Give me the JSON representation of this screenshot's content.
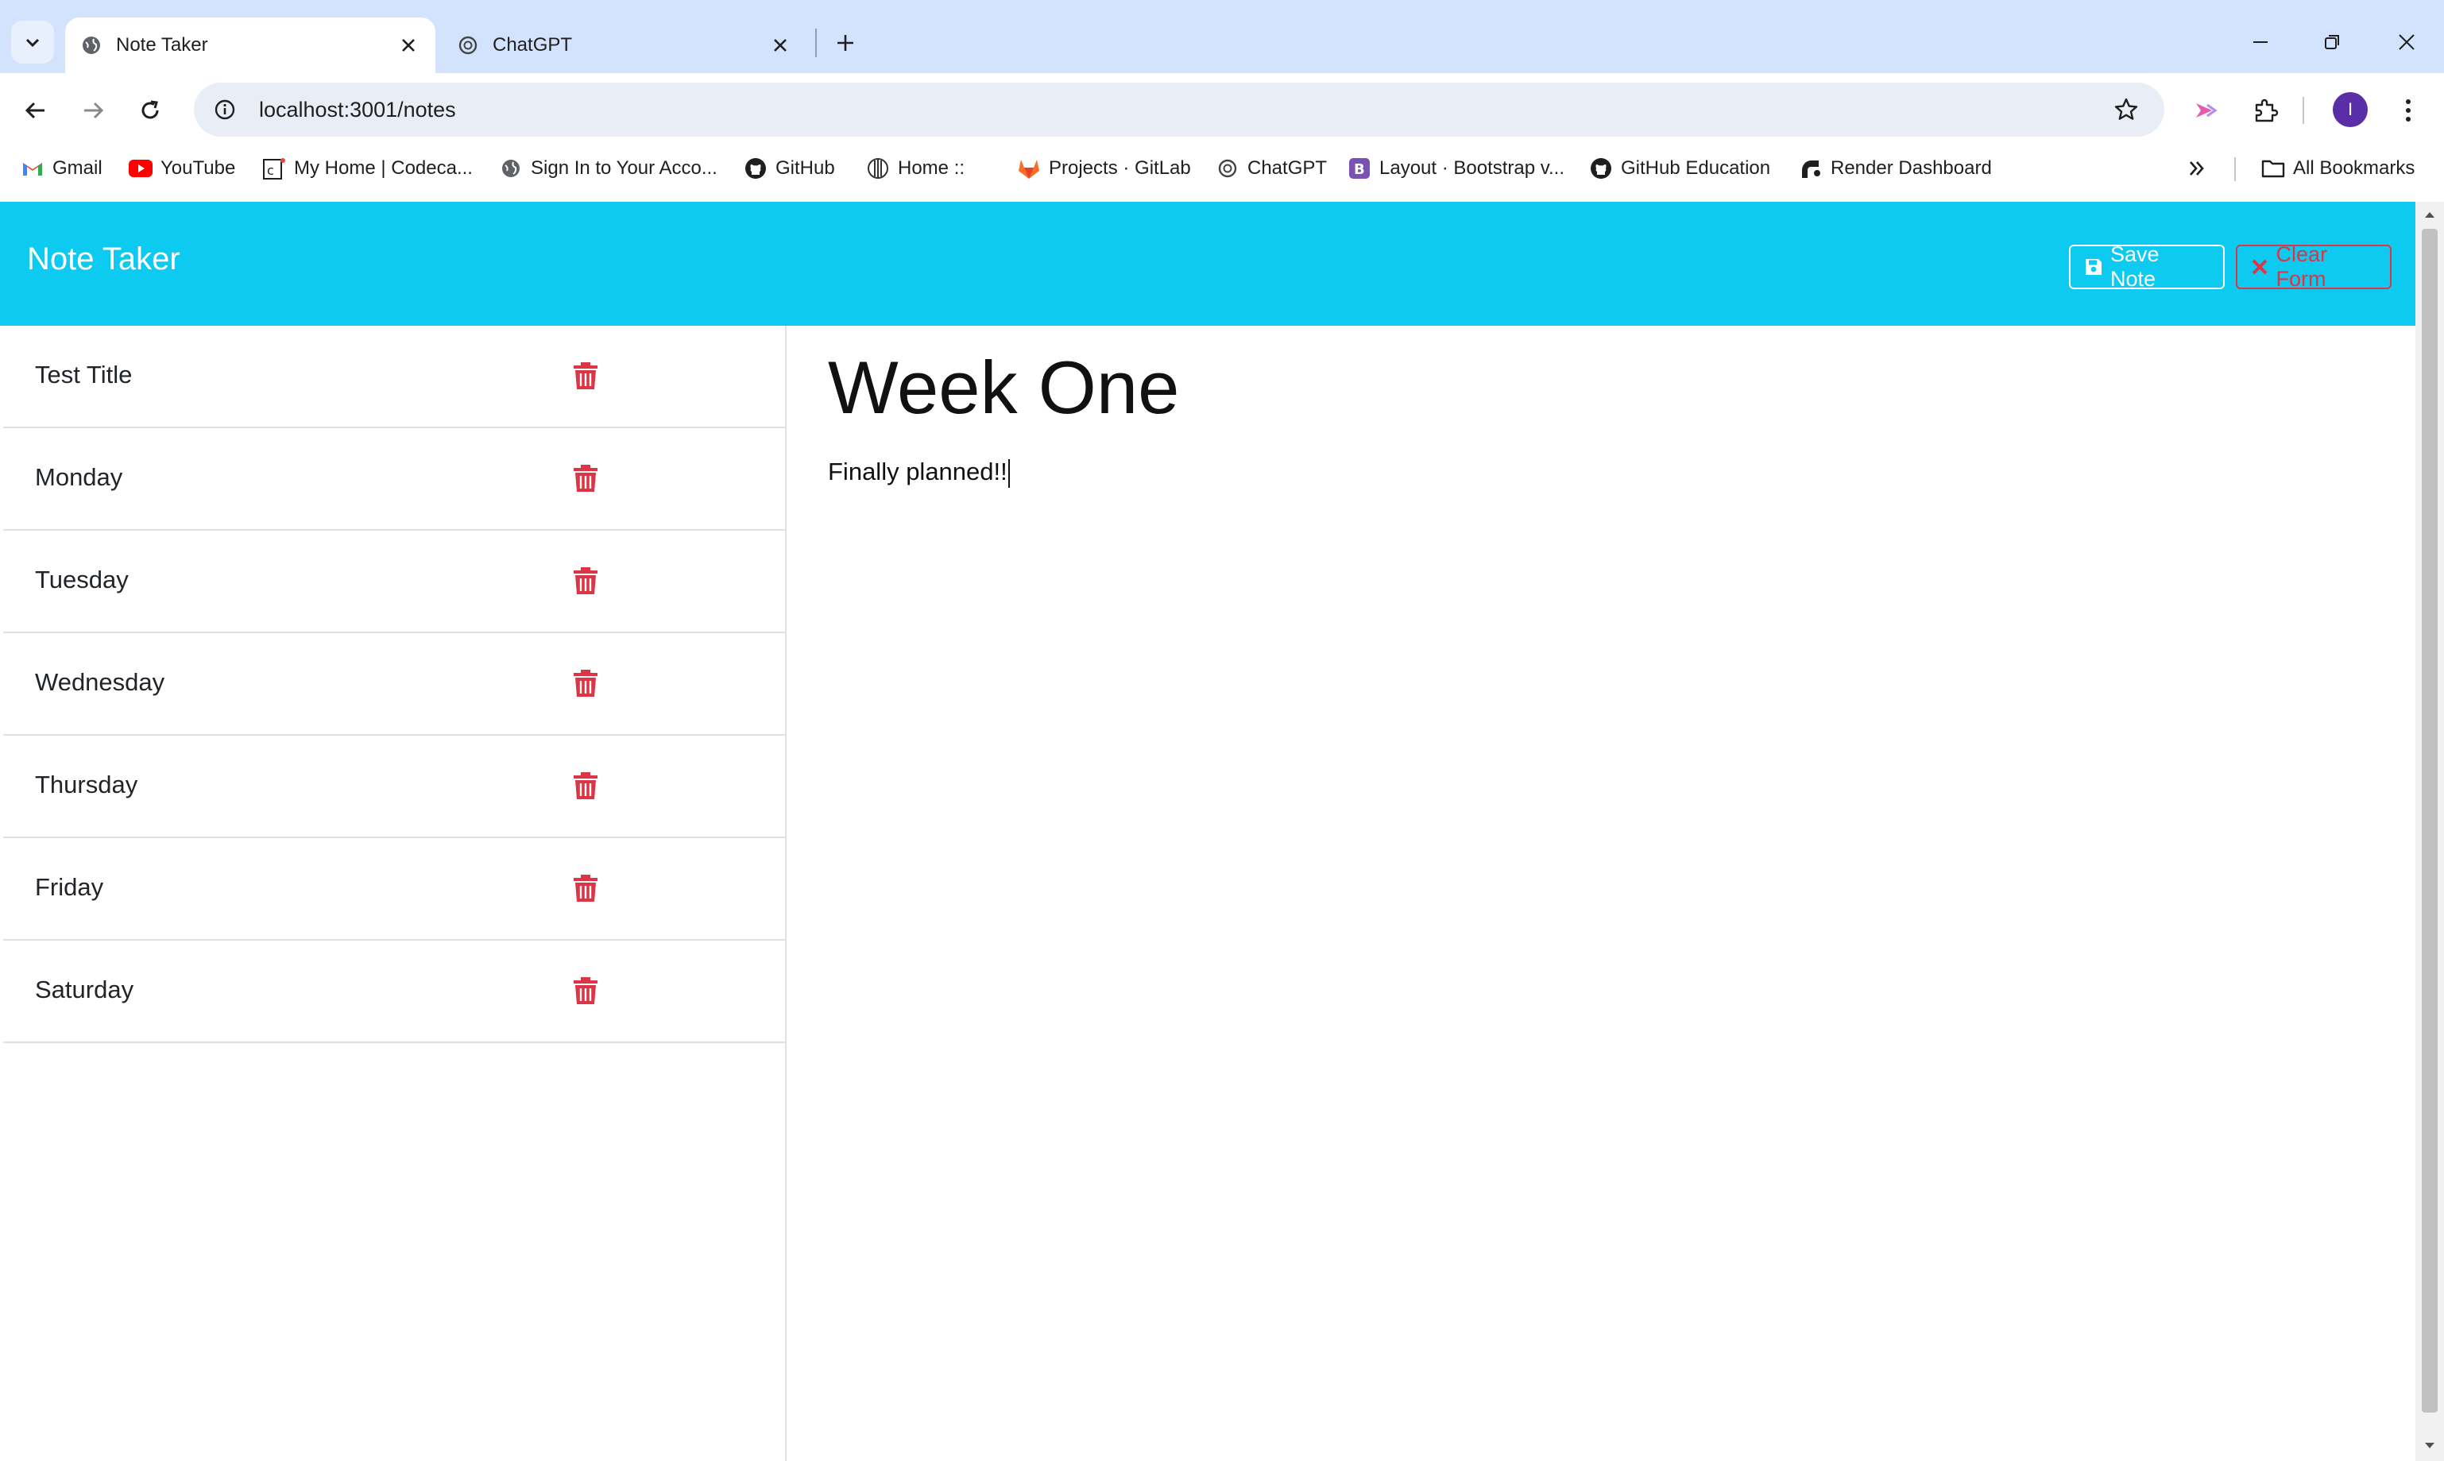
{
  "browser": {
    "tabs": [
      {
        "title": "Note Taker",
        "icon": "globe-icon",
        "active": true
      },
      {
        "title": "ChatGPT",
        "icon": "chatgpt-icon",
        "active": false
      }
    ],
    "url": "localhost:3001/notes",
    "profile_initial": "I",
    "bookmarks": [
      {
        "label": "Gmail",
        "icon": "gmail-icon"
      },
      {
        "label": "YouTube",
        "icon": "youtube-icon"
      },
      {
        "label": "My Home | Codeca...",
        "icon": "codecademy-icon"
      },
      {
        "label": "Sign In to Your Acco...",
        "icon": "globe-icon"
      },
      {
        "label": "GitHub",
        "icon": "github-icon"
      },
      {
        "label": "Home ::",
        "icon": "home-icon"
      },
      {
        "label": "Projects · GitLab",
        "icon": "gitlab-icon"
      },
      {
        "label": "ChatGPT",
        "icon": "chatgpt-icon"
      },
      {
        "label": "Layout · Bootstrap v...",
        "icon": "bootstrap-icon"
      },
      {
        "label": "GitHub Education",
        "icon": "github-icon"
      },
      {
        "label": "Render Dashboard",
        "icon": "render-icon"
      }
    ],
    "all_bookmarks_label": "All Bookmarks"
  },
  "app": {
    "brand": "Note Taker",
    "save_label": "Save Note",
    "clear_label": "Clear Form",
    "accent_color": "#0dcaf0",
    "danger_color": "#dc3545"
  },
  "notes": [
    {
      "title": "Test Title"
    },
    {
      "title": "Monday"
    },
    {
      "title": "Tuesday"
    },
    {
      "title": "Wednesday"
    },
    {
      "title": "Thursday"
    },
    {
      "title": "Friday"
    },
    {
      "title": "Saturday"
    }
  ],
  "active_note": {
    "title": "Week One",
    "text": "Finally planned!!"
  }
}
